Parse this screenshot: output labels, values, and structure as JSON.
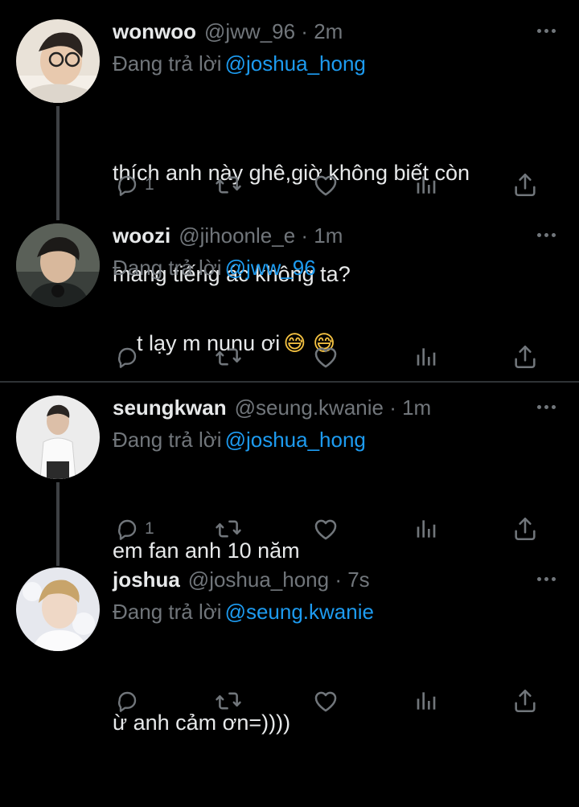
{
  "reply_prefix": "Đang trả lời",
  "tweets": [
    {
      "name": "wonwoo",
      "handle_time": "@jww_96 · 2m",
      "reply_to": "@joshua_hong",
      "text_line1": "thích anh này ghê,giờ không biết còn",
      "text_line2": "mang tiếng ác không ta?",
      "reply_count": "1"
    },
    {
      "name": "woozi",
      "handle_time": "@jihoonle_e · 1m",
      "reply_to": "@jww_96",
      "text_line1": "t lạy m nunu ơi",
      "emoji": "😅 😅",
      "reply_count": ""
    },
    {
      "name": "seungkwan",
      "handle_time": "@seung.kwanie · 1m",
      "reply_to": "@joshua_hong",
      "text_line1": "em fan anh 10 năm",
      "reply_count": "1"
    },
    {
      "name": "joshua",
      "handle_time": "@joshua_hong · 7s",
      "reply_to": "@seung.kwanie",
      "text_line1": "ừ anh cảm ơn=))))",
      "reply_count": ""
    }
  ],
  "icons": {
    "reply": "comment-icon",
    "retweet": "retweet-icon",
    "like": "heart-icon",
    "views": "analytics-icon",
    "share": "share-icon",
    "more": "more-icon"
  },
  "colors": {
    "background": "#000000",
    "text": "#e7e9ea",
    "muted": "#71767b",
    "mention": "#1d9bf0",
    "divider": "#2f3336"
  }
}
